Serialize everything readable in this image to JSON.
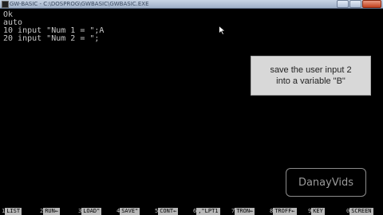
{
  "window": {
    "title": "GW-BASIC - C:\\DOSPROG\\GWBASIC\\GWBASIC.EXE"
  },
  "console": {
    "lines": [
      "Ok",
      "auto",
      "10 input \"Num 1 = \";A",
      "20 input \"Num 2 = \";"
    ]
  },
  "callout": {
    "line1": "save the user input 2",
    "line2": "into a variable \"B\""
  },
  "watermark": {
    "text": "DanayVids"
  },
  "function_keys": [
    {
      "num": "1",
      "label": "LIST"
    },
    {
      "num": "2",
      "label": "RUN←"
    },
    {
      "num": "3",
      "label": "LOAD\""
    },
    {
      "num": "4",
      "label": "SAVE\""
    },
    {
      "num": "5",
      "label": "CONT←"
    },
    {
      "num": "6",
      "label": ",\"LPT1"
    },
    {
      "num": "7",
      "label": "TRON←"
    },
    {
      "num": "8",
      "label": "TROFF←"
    },
    {
      "num": "9",
      "label": "KEY"
    },
    {
      "num": "0",
      "label": "SCREEN"
    }
  ],
  "colors": {
    "console_bg": "#000000",
    "console_text": "#c8c8c8",
    "fkey_label_bg": "#b8b8b8"
  }
}
